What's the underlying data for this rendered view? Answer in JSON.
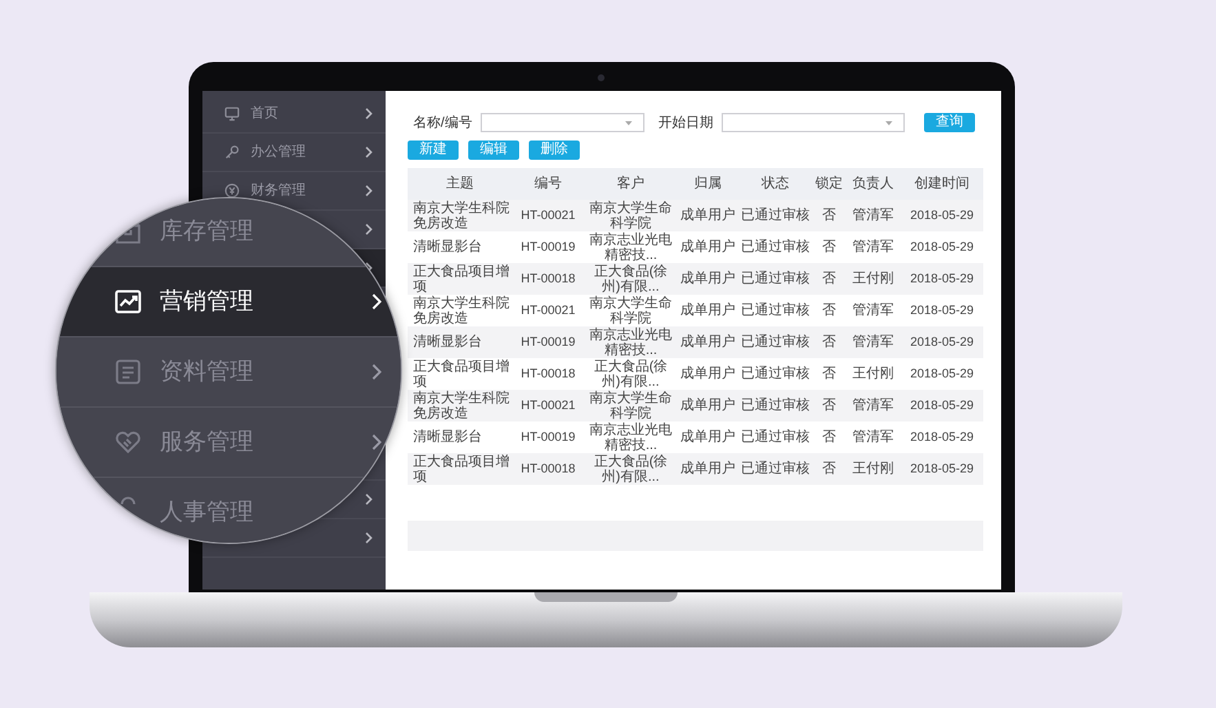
{
  "sidebar": {
    "items": [
      {
        "label": "首页"
      },
      {
        "label": "办公管理"
      },
      {
        "label": "财务管理"
      }
    ]
  },
  "magnifier": {
    "items": [
      {
        "label": "库存管理",
        "selected": false
      },
      {
        "label": "营销管理",
        "selected": true
      },
      {
        "label": "资料管理",
        "selected": false
      },
      {
        "label": "服务管理",
        "selected": false
      },
      {
        "label": "人事管理",
        "selected": false
      }
    ]
  },
  "filters": [
    {
      "label": "名称/编号"
    },
    {
      "label": "开始日期"
    }
  ],
  "search_button": "查询",
  "actions": [
    "新建",
    "编辑",
    "删除"
  ],
  "table": {
    "columns": [
      "主题",
      "编号",
      "客户",
      "归属",
      "状态",
      "锁定",
      "负责人",
      "创建时间"
    ],
    "rows": [
      [
        "南京大学生科院免房改造",
        "HT-00021",
        "南京大学生命科学院",
        "成单用户",
        "已通过审核",
        "否",
        "管清军",
        "2018-05-29"
      ],
      [
        "清晰显影台",
        "HT-00019",
        "南京志业光电精密技...",
        "成单用户",
        "已通过审核",
        "否",
        "管清军",
        "2018-05-29"
      ],
      [
        "正大食品项目增项",
        "HT-00018",
        "正大食品(徐州)有限...",
        "成单用户",
        "已通过审核",
        "否",
        "王付刚",
        "2018-05-29"
      ],
      [
        "南京大学生科院免房改造",
        "HT-00021",
        "南京大学生命科学院",
        "成单用户",
        "已通过审核",
        "否",
        "管清军",
        "2018-05-29"
      ],
      [
        "清晰显影台",
        "HT-00019",
        "南京志业光电精密技...",
        "成单用户",
        "已通过审核",
        "否",
        "管清军",
        "2018-05-29"
      ],
      [
        "正大食品项目增项",
        "HT-00018",
        "正大食品(徐州)有限...",
        "成单用户",
        "已通过审核",
        "否",
        "王付刚",
        "2018-05-29"
      ],
      [
        "南京大学生科院免房改造",
        "HT-00021",
        "南京大学生命科学院",
        "成单用户",
        "已通过审核",
        "否",
        "管清军",
        "2018-05-29"
      ],
      [
        "清晰显影台",
        "HT-00019",
        "南京志业光电精密技...",
        "成单用户",
        "已通过审核",
        "否",
        "管清军",
        "2018-05-29"
      ],
      [
        "正大食品项目增项",
        "HT-00018",
        "正大食品(徐州)有限...",
        "成单用户",
        "已通过审核",
        "否",
        "王付刚",
        "2018-05-29"
      ]
    ]
  }
}
